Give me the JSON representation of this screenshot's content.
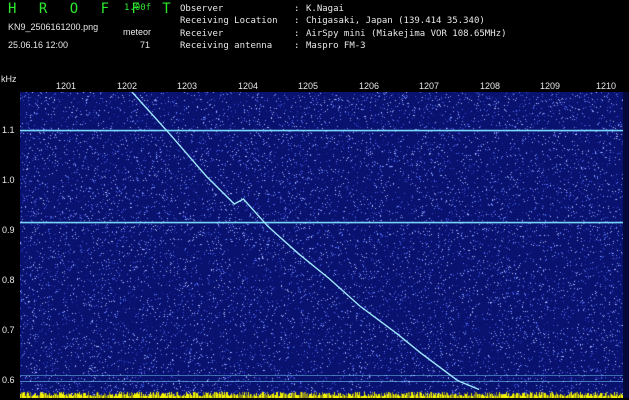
{
  "header": {
    "brand": "H R O F F T",
    "version": "1.00f",
    "filename": "KN9_2506161200.png",
    "datetime": "25.06.16 12:00",
    "meteor_label": "meteor",
    "meteor_count": "71"
  },
  "info": [
    {
      "label": "Observer",
      "value": "K.Nagai"
    },
    {
      "label": "Receiving Location",
      "value": "Chigasaki, Japan (139.414 35.340)"
    },
    {
      "label": "Receiver",
      "value": "AirSpy mini (Miakejima VOR 108.65MHz)"
    },
    {
      "label": "Receiving antenna",
      "value": "Maspro FM-3"
    }
  ],
  "axes": {
    "y_unit": "kHz",
    "x_ticks": [
      "1201",
      "1202",
      "1203",
      "1204",
      "1205",
      "1206",
      "1207",
      "1208",
      "1209",
      "1210"
    ],
    "y_ticks": [
      "1.1",
      "1.0",
      "0.9",
      "0.8",
      "0.7",
      "0.6"
    ]
  },
  "colors": {
    "background": "#0a1270",
    "noise": "#5a78ff",
    "trace": "#9fe8ff",
    "carrier": "#7fe0ff",
    "text": "#e8e8e8",
    "brand": "#2ee82e",
    "bottom_band": "#f2f200"
  },
  "chart_data": {
    "type": "heatmap",
    "x_tick_values": [
      1201,
      1202,
      1203,
      1204,
      1205,
      1206,
      1207,
      1208,
      1209,
      1210
    ],
    "y_tick_values": [
      1.1,
      1.0,
      0.9,
      0.8,
      0.7,
      0.6
    ],
    "xlim": [
      1200.45,
      1210.3
    ],
    "ylim": [
      0.575,
      1.19
    ],
    "carrier_lines_khz": [
      1.1125,
      0.9275,
      0.62,
      0.608
    ],
    "meteor_trace": {
      "x": [
        1202.28,
        1202.9,
        1203.5,
        1203.95,
        1204.1,
        1204.5,
        1205.0,
        1205.5,
        1206.0,
        1206.6,
        1207.0,
        1207.6,
        1207.95
      ],
      "y": [
        1.19,
        1.105,
        1.02,
        0.965,
        0.975,
        0.92,
        0.865,
        0.815,
        0.76,
        0.705,
        0.665,
        0.61,
        0.592
      ]
    }
  }
}
